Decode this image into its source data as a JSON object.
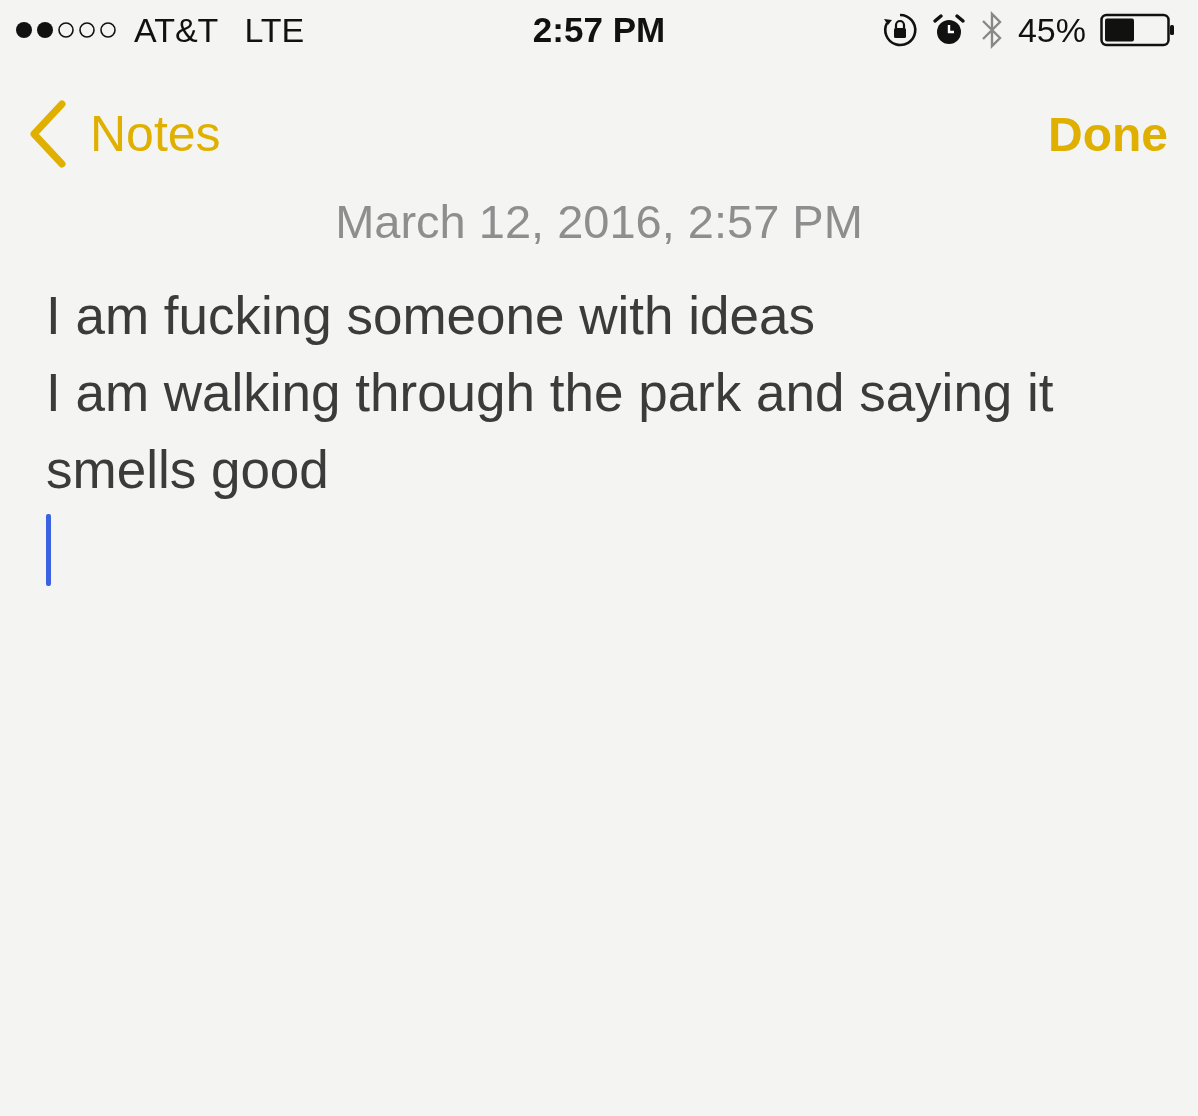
{
  "status_bar": {
    "carrier": "AT&T",
    "network": "LTE",
    "time": "2:57 PM",
    "battery": "45%"
  },
  "nav": {
    "back": "Notes",
    "done": "Done"
  },
  "note": {
    "date": "March 12, 2016, 2:57 PM",
    "lines": [
      "I am fucking someone with ideas",
      "I am walking through the park and saying it",
      "smells good"
    ]
  }
}
